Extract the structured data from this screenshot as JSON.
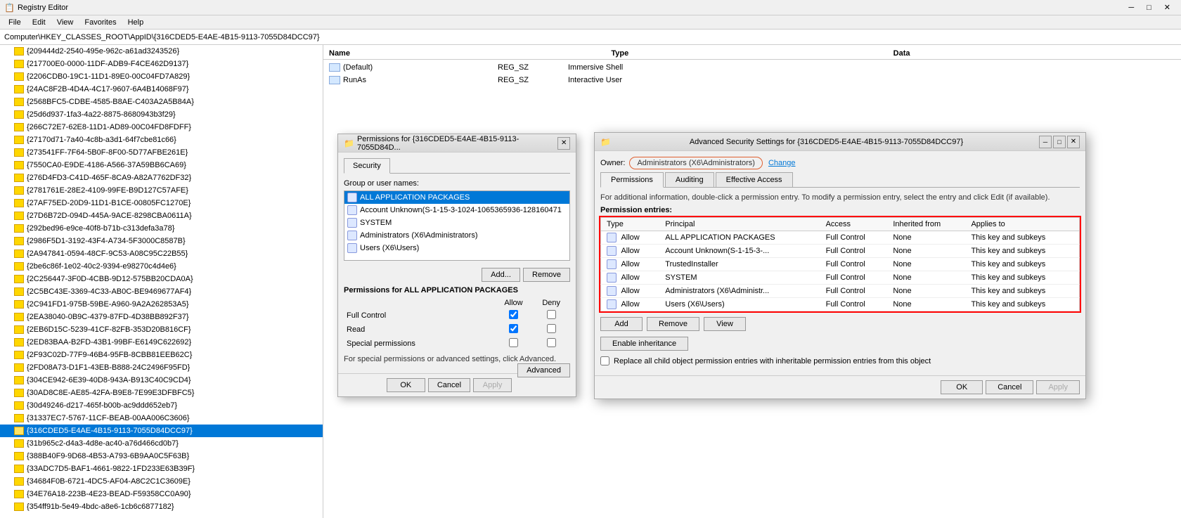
{
  "app": {
    "title": "Registry Editor",
    "icon": "📋"
  },
  "menu": {
    "items": [
      "File",
      "Edit",
      "View",
      "Favorites",
      "Help"
    ]
  },
  "address": {
    "label": "Computer\\HKEY_CLASSES_ROOT\\AppID\\{316CDED5-E4AE-4B15-9113-7055D84DCC97}"
  },
  "tree": {
    "items": [
      "{209444d2-2540-495e-962c-a61ad3243526}",
      "{217700E0-0000-11DF-ADB9-F4CE462D9137}",
      "{2206CDB0-19C1-11D1-89E0-00C04FD7A829}",
      "{24AC8F2B-4D4A-4C17-9607-6A4B14068F97}",
      "{2568BFC5-CDBE-4585-B8AE-C403A2A5B84A}",
      "{25d6d937-1fa3-4a22-8875-8680943b3f29}",
      "{266C72E7-62E8-11D1-AD89-00C04FD8FDFF}",
      "{27170d71-7a40-4c8b-a3d1-64f7cbe81c66}",
      "{273541FF-7F64-5B0F-8F00-5D77AFBE261E}",
      "{7550CA0-E9DE-4186-A566-37A59BB6CA69}",
      "{276D4FD3-C41D-465F-8CA9-A82A7762DF32}",
      "{2781761E-28E2-4109-99FE-B9D127C57AFE}",
      "{27AF75ED-20D9-11D1-B1CE-00805FC1270E}",
      "{27D6B72D-094D-445A-9ACE-8298CBA0611A}",
      "{292bed96-e9ce-40f8-b71b-c313defa3a78}",
      "{2986F5D1-3192-43F4-A734-5F3000C8587B}",
      "{2A947841-0594-48CF-9C53-A08C95C22B55}",
      "{2be6c86f-1e02-40c2-9394-e98270c4d4e6}",
      "{2C256447-3F0D-4CBB-9D12-575BB20CDA0A}",
      "{2C5BC43E-3369-4C33-AB0C-BE9469677AF4}",
      "{2C941FD1-975B-59BE-A960-9A2A262853A5}",
      "{2EA38040-0B9C-4379-87FD-4D38BB892F37}",
      "{2EB6D15C-5239-41CF-82FB-353D20B816CF}",
      "{2ED83BAA-B2FD-43B1-99BF-E6149C622692}",
      "{2F93C02D-77F9-46B4-95FB-8CBB81EEB62C}",
      "{2FD08A73-D1F1-43EB-B888-24C2496F95FD}",
      "{304CE942-6E39-40D8-943A-B913C40C9CD4}",
      "{30AD8C8E-AE85-42FA-B9E8-7E99E3DFBFC5}",
      "{30d49246-d217-465f-b00b-ac9ddd652eb7}",
      "{31337EC7-5767-11CF-BEAB-00AA006C3606}",
      "{316CDED5-E4AE-4B15-9113-7055D84DCC97}",
      "{31b965c2-d4a3-4d8e-ac40-a76d466cd0b7}",
      "{388B40F9-9D68-4B53-A793-6B9AA0C5F63B}",
      "{33ADC7D5-BAF1-4661-9822-1FD233E63B39F}",
      "{34684F0B-6721-4DC5-AF04-A8C2C1C3609E}",
      "{34E76A18-223B-4E23-BEAD-F59358CC0A90}",
      "{354ff91b-5e49-4bdc-a8e6-1cb6c6877182}"
    ],
    "selectedIndex": 30
  },
  "content": {
    "columns": [
      "Name",
      "Type",
      "Data"
    ],
    "rows": [
      {
        "name": "(Default)",
        "type": "REG_SZ",
        "data": "Immersive Shell"
      },
      {
        "name": "RunAs",
        "type": "REG_SZ",
        "data": "Interactive User"
      }
    ]
  },
  "permissions_dialog": {
    "title": "Permissions for {316CDED5-E4AE-4B15-9113-7055D84D...",
    "tab": "Security",
    "group_label": "Group or user names:",
    "users": [
      {
        "name": "ALL APPLICATION PACKAGES",
        "selected": true
      },
      {
        "name": "Account Unknown(S-1-15-3-1024-1065365936-128160471",
        "selected": false
      },
      {
        "name": "SYSTEM",
        "selected": false
      },
      {
        "name": "Administrators (X6\\Administrators)",
        "selected": false
      },
      {
        "name": "Users (X6\\Users)",
        "selected": false
      }
    ],
    "add_label": "Add...",
    "remove_label": "Remove",
    "permissions_for_label": "Permissions for ALL APPLICATION PACKAGES",
    "perm_cols": [
      "",
      "Allow",
      "Deny"
    ],
    "permissions": [
      {
        "name": "Full Control",
        "allow": true,
        "deny": false
      },
      {
        "name": "Read",
        "allow": true,
        "deny": false
      },
      {
        "name": "Special permissions",
        "allow": false,
        "deny": false
      }
    ],
    "advanced_text": "For special permissions or advanced settings, click Advanced.",
    "advanced_label": "Advanced",
    "ok_label": "OK",
    "cancel_label": "Cancel",
    "apply_label": "Apply"
  },
  "advanced_dialog": {
    "title": "Advanced Security Settings for {316CDED5-E4AE-4B15-9113-7055D84DCC97}",
    "owner_label": "Owner:",
    "owner_value": "Administrators (X6\\Administrators)",
    "change_label": "Change",
    "tabs": [
      "Permissions",
      "Auditing",
      "Effective Access"
    ],
    "active_tab": "Permissions",
    "info_text": "For additional information, double-click a permission entry. To modify a permission entry, select the entry and click Edit (if available).",
    "perm_entries_label": "Permission entries:",
    "columns": [
      "Type",
      "Principal",
      "Access",
      "Inherited from",
      "Applies to"
    ],
    "entries": [
      {
        "type": "Allow",
        "principal": "ALL APPLICATION PACKAGES",
        "access": "Full Control",
        "inherited": "None",
        "applies": "This key and subkeys"
      },
      {
        "type": "Allow",
        "principal": "Account Unknown(S-1-15-3-...",
        "access": "Full Control",
        "inherited": "None",
        "applies": "This key and subkeys"
      },
      {
        "type": "Allow",
        "principal": "TrustedInstaller",
        "access": "Full Control",
        "inherited": "None",
        "applies": "This key and subkeys"
      },
      {
        "type": "Allow",
        "principal": "SYSTEM",
        "access": "Full Control",
        "inherited": "None",
        "applies": "This key and subkeys"
      },
      {
        "type": "Allow",
        "principal": "Administrators (X6\\Administr...",
        "access": "Full Control",
        "inherited": "None",
        "applies": "This key and subkeys"
      },
      {
        "type": "Allow",
        "principal": "Users (X6\\Users)",
        "access": "Full Control",
        "inherited": "None",
        "applies": "This key and subkeys"
      }
    ],
    "add_label": "Add",
    "remove_label": "Remove",
    "view_label": "View",
    "enable_inheritance_label": "Enable inheritance",
    "replace_checkbox_label": "Replace all child object permission entries with inheritable permission entries from this object",
    "ok_label": "OK",
    "cancel_label": "Cancel",
    "apply_label": "Apply"
  }
}
